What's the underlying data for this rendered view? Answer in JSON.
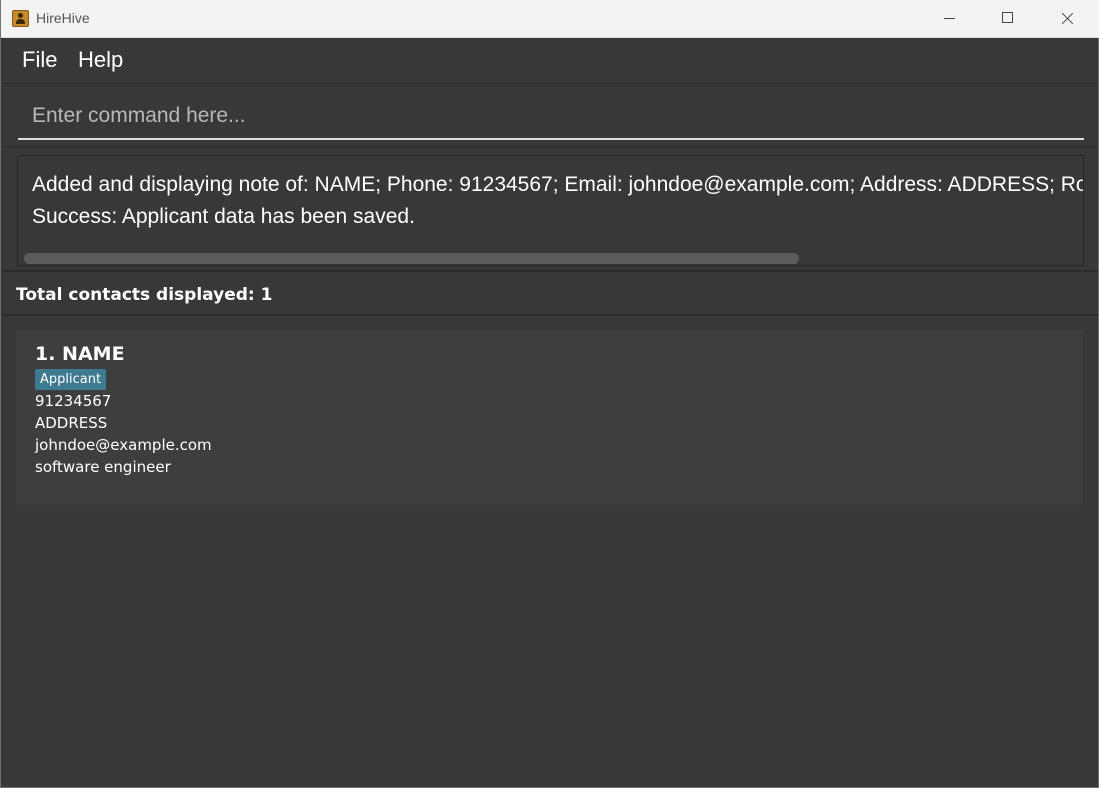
{
  "window": {
    "title": "HireHive",
    "icon": "address-book-icon",
    "controls": [
      "minimize-icon",
      "maximize-icon",
      "close-icon"
    ]
  },
  "menu": {
    "file": "File",
    "help": "Help"
  },
  "command": {
    "placeholder": "Enter command here...",
    "value": ""
  },
  "result": {
    "line1": "Added and displaying note of: NAME; Phone: 91234567; Email: johndoe@example.com; Address: ADDRESS; Role: so",
    "line2": "Success: Applicant data has been saved."
  },
  "contacts": {
    "count_label": "Total contacts displayed: 1",
    "items": [
      {
        "index_name": "1.  NAME",
        "tag": "Applicant",
        "phone": "91234567",
        "address": "ADDRESS",
        "email": "johndoe@example.com",
        "role": "software engineer"
      }
    ]
  },
  "colors": {
    "background": "#383838",
    "card": "#3c3e3f",
    "tag": "#3e7b91",
    "text": "#ffffff"
  }
}
